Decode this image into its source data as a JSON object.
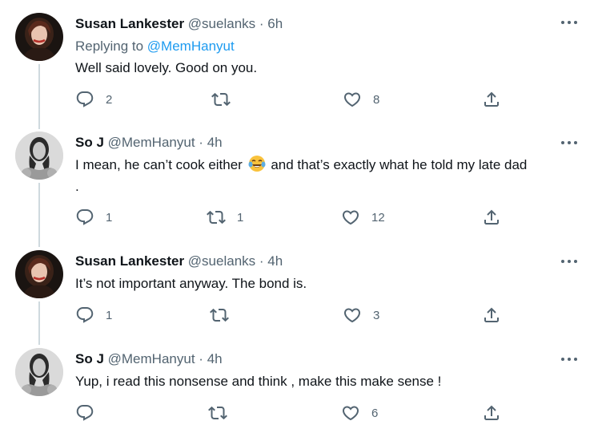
{
  "tweets": [
    {
      "name": "Susan Lankester",
      "handle": "@suelanks",
      "sep": "·",
      "time": "6h",
      "replying_prefix": "Replying to",
      "replying_to": "@MemHanyut",
      "text_lines": [
        "Well said lovely. Good on you."
      ],
      "reply_count": "2",
      "retweet_count": "",
      "like_count": "8"
    },
    {
      "name": "So J",
      "handle": "@MemHanyut",
      "sep": "·",
      "time": "4h",
      "text_before_emoji": "I mean, he can’t cook either",
      "emoji": "face-with-tears-of-joy",
      "text_after_emoji": "and that’s exactly what he told my late dad",
      "text_line2": ".",
      "reply_count": "1",
      "retweet_count": "1",
      "like_count": "12"
    },
    {
      "name": "Susan Lankester",
      "handle": "@suelanks",
      "sep": "·",
      "time": "4h",
      "text_lines": [
        "It’s not important anyway. The bond is."
      ],
      "reply_count": "1",
      "retweet_count": "",
      "like_count": "3"
    },
    {
      "name": "So J",
      "handle": "@MemHanyut",
      "sep": "·",
      "time": "4h",
      "text_lines": [
        "Yup, i read this nonsense and think , make this make sense !"
      ],
      "reply_count": "",
      "retweet_count": "",
      "like_count": "6"
    }
  ],
  "icons": {
    "more": "more-horizontal-icon",
    "reply": "reply-icon",
    "retweet": "retweet-icon",
    "like": "heart-icon",
    "share": "share-icon"
  },
  "colors": {
    "text": "#0f1419",
    "secondary": "#536471",
    "link": "#1d9bf0",
    "thread_line": "#cfd9de"
  }
}
